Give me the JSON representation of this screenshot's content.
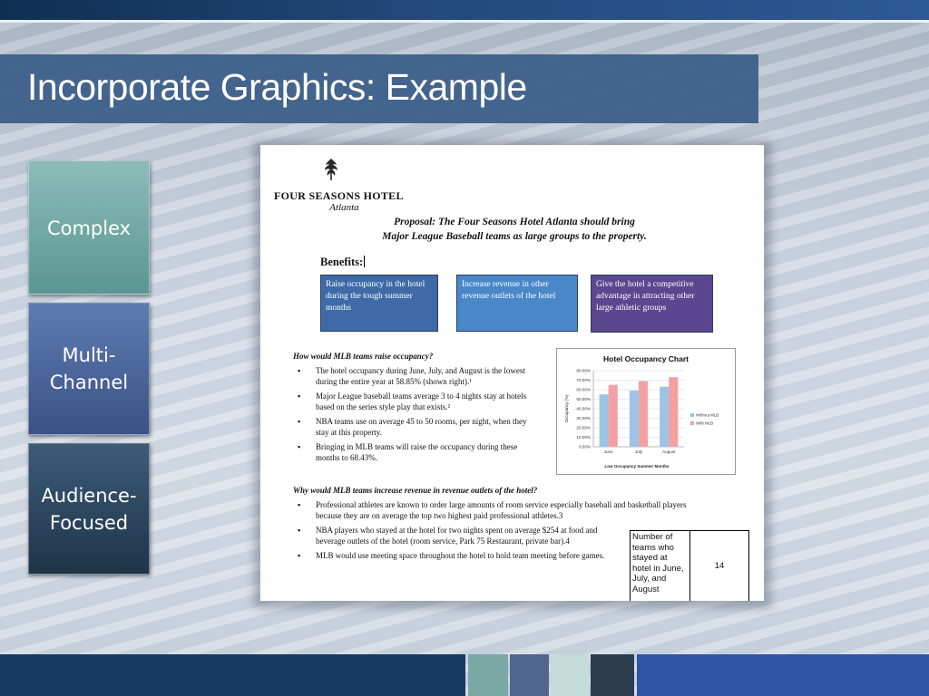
{
  "slide": {
    "title": "Incorporate Graphics: Example",
    "side_boxes": [
      "Complex",
      "Multi-Channel",
      "Audience-Focused"
    ]
  },
  "document": {
    "logo": {
      "name": "Four Seasons Hotel",
      "name_display": "FOUR SEASONS HOTEL",
      "location": "Atlanta"
    },
    "proposal_line1": "Proposal: The Four Seasons Hotel Atlanta should bring",
    "proposal_line2": "Major League Baseball teams as large groups to the property.",
    "benefits_label": "Benefits:",
    "benefits": [
      "Raise occupancy in the hotel during the tough summer months",
      "Increase revenue in other revenue outlets of the hotel",
      "Give the hotel a competitive advantage in attracting other large athletic groups"
    ],
    "question1": "How would MLB teams raise occupancy?",
    "question1_bullets": [
      "The hotel occupancy during June, July, and August is the lowest during the entire year at 58.85% (shown right).¹",
      "Major League baseball teams average 3 to 4 nights stay at hotels based on the series style play that exists.²",
      "NBA teams use on average 45 to 50 rooms, per night, when they stay at this property.",
      "Bringing in MLB teams will raise the occupancy during these months to 68.43%."
    ],
    "question2": "Why would MLB teams increase revenue in revenue outlets of the hotel?",
    "question2_bullets": [
      "Professional athletes are known to order large amounts of room service especially baseball and basketball players because they are on average the top two highest paid professional athletes.3"
    ],
    "question2_bullets_b": [
      "NBA players who stayed at the hotel for two nights spent on average $254 at food and beverage outlets of the hotel (room service, Park 75 Restaurant, private bar).4",
      "MLB would use meeting space throughout the hotel to hold team meeting before games."
    ],
    "table": {
      "label": "Number of teams who stayed at hotel in June, July, and August",
      "value": "14"
    }
  },
  "chart_data": {
    "type": "bar",
    "title": "Hotel Occupancy Chart",
    "xlabel": "Low Occupancy Summer Months",
    "ylabel": "Occupancy (%)",
    "categories": [
      "June",
      "July",
      "August"
    ],
    "series": [
      {
        "name": "Without MLB",
        "values": [
          55,
          59,
          63
        ],
        "color": "#9dc3e6"
      },
      {
        "name": "With MLB",
        "values": [
          65,
          69,
          73
        ],
        "color": "#f4a0a0"
      }
    ],
    "ylim": [
      0,
      80
    ],
    "yticks": [
      "0.00%",
      "10.00%",
      "20.00%",
      "30.00%",
      "40.00%",
      "50.00%",
      "60.00%",
      "70.00%",
      "80.00%"
    ],
    "grid": true,
    "legend": "right"
  },
  "colors": {
    "title_bar": "#3d5f89",
    "complex": "#6fa7a2",
    "multi_channel": "#4a659a",
    "audience_focused": "#2c4660"
  }
}
